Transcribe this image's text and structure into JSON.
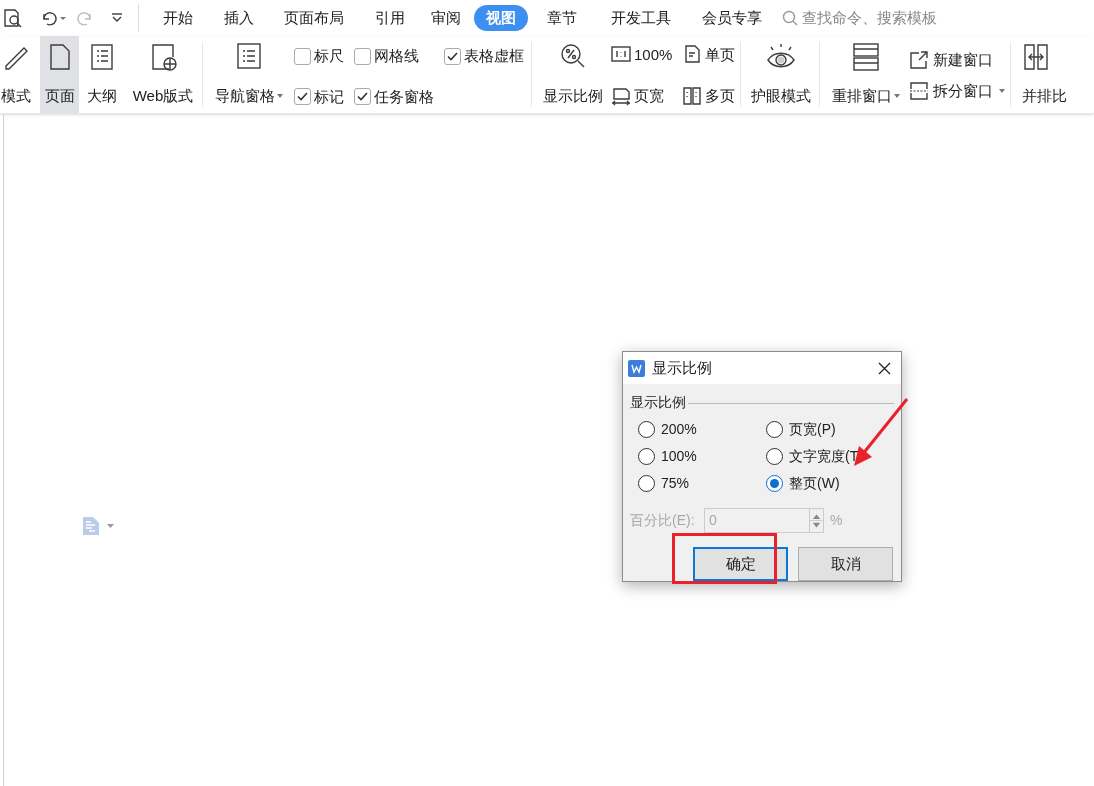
{
  "tabs": [
    {
      "label": "开始",
      "selected": false
    },
    {
      "label": "插入",
      "selected": false
    },
    {
      "label": "页面布局",
      "selected": false
    },
    {
      "label": "引用",
      "selected": false
    },
    {
      "label": "审阅",
      "selected": false
    },
    {
      "label": "视图",
      "selected": true
    },
    {
      "label": "章节",
      "selected": false
    },
    {
      "label": "开发工具",
      "selected": false
    },
    {
      "label": "会员专享",
      "selected": false
    }
  ],
  "search": {
    "placeholder": "查找命令、搜索模板"
  },
  "ribbon": {
    "view_modes": [
      {
        "label": "模式",
        "selected": false
      },
      {
        "label": "页面",
        "selected": true
      },
      {
        "label": "大纲",
        "selected": false
      },
      {
        "label": "Web版式",
        "selected": false
      }
    ],
    "navigation_pane": {
      "label": "导航窗格",
      "dropdown": true
    },
    "checkboxes": [
      {
        "label": "标尺",
        "checked": false
      },
      {
        "label": "标记",
        "checked": true
      },
      {
        "label": "网格线",
        "checked": false
      },
      {
        "label": "任务窗格",
        "checked": true
      },
      {
        "label": "表格虚框",
        "checked": true
      }
    ],
    "zoom": {
      "label": "显示比例"
    },
    "zoom_options": [
      {
        "label": "100%"
      },
      {
        "label": "页宽"
      },
      {
        "label": "单页"
      },
      {
        "label": "多页"
      }
    ],
    "eye_mode": {
      "label": "护眼模式"
    },
    "arrange": {
      "label": "重排窗口",
      "dropdown": true
    },
    "window_options": [
      {
        "label": "新建窗口",
        "dropdown": false
      },
      {
        "label": "拆分窗口",
        "dropdown": true
      }
    ],
    "compare": {
      "label": "并排比"
    }
  },
  "dialog": {
    "title": "显示比例",
    "group_label": "显示比例",
    "options": [
      {
        "label": "200%",
        "selected": false
      },
      {
        "label": "页宽(P)",
        "selected": false
      },
      {
        "label": "100%",
        "selected": false
      },
      {
        "label": "文字宽度(T",
        "selected": false
      },
      {
        "label": "75%",
        "selected": false
      },
      {
        "label": "整页(W)",
        "selected": true
      }
    ],
    "percent": {
      "label": "百分比(E):",
      "value": "0",
      "unit": "%",
      "disabled": true
    },
    "buttons": [
      {
        "label": "确定",
        "default": true
      },
      {
        "label": "取消",
        "default": false
      }
    ]
  }
}
